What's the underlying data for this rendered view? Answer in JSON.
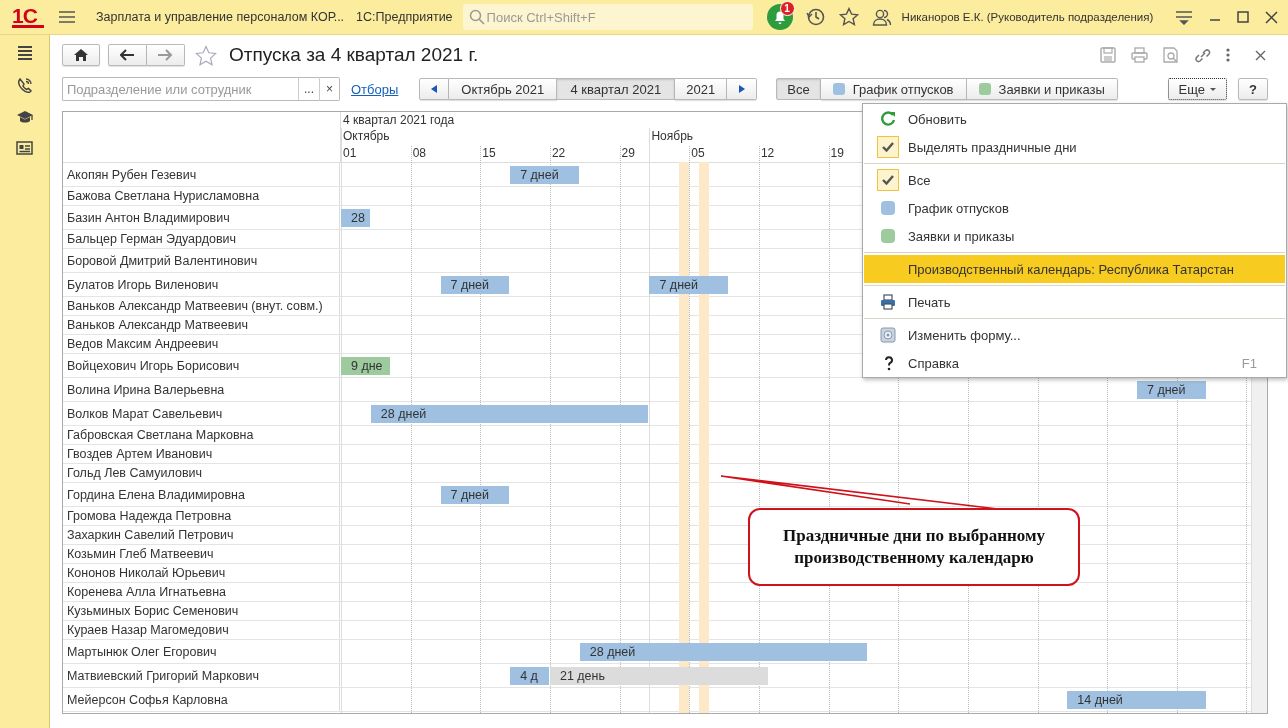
{
  "app_bar": {
    "logo": "1С",
    "title": "Зарплата и управление персоналом КОР...",
    "product": "1С:Предприятие",
    "search": {
      "placeholder": "Поиск Ctrl+Shift+F"
    },
    "notifications": "1",
    "user": "Никаноров Е.К. (Руководитель подразделения)"
  },
  "form": {
    "title": "Отпуска за 4 квартал 2021 г.",
    "filter": {
      "placeholder": "Подразделение или сотрудник"
    },
    "filter_buttons": [
      "...",
      "×"
    ],
    "filters_link": "Отборы",
    "periods": [
      {
        "label": "Октябрь 2021",
        "selected": false
      },
      {
        "label": "4 квартал 2021",
        "selected": true
      },
      {
        "label": "2021",
        "selected": false
      }
    ],
    "views": [
      {
        "label": "Все",
        "selected": true
      },
      {
        "label": "График отпусков",
        "color": "#9fc0e0",
        "selected": false
      },
      {
        "label": "Заявки и приказы",
        "color": "#9dcb9d",
        "selected": false
      }
    ],
    "more_button": "Еще",
    "help_button": "?"
  },
  "timeline": {
    "period": "4 квартал 2021 года",
    "months": [
      "Октябрь",
      "Ноябрь"
    ],
    "ticks": [
      "01",
      "08",
      "15",
      "22",
      "29",
      "05",
      "12",
      "19"
    ],
    "rows": [
      {
        "name": "Акопян Рубен Гезевич",
        "bars": [
          {
            "kind": "schedule",
            "label": "7 дней"
          }
        ]
      },
      {
        "name": "Бажова Светлана Нурисламовна",
        "bars": []
      },
      {
        "name": "Базин Антон Владимирович",
        "bars": [
          {
            "kind": "schedule",
            "label": "28"
          }
        ]
      },
      {
        "name": "Бальцер Герман Эдуардович",
        "bars": []
      },
      {
        "name": "Боровой Дмитрий Валентинович",
        "bars": []
      },
      {
        "name": "Булатов Игорь Виленович",
        "bars": [
          {
            "kind": "schedule",
            "label": "7 дней"
          },
          {
            "kind": "schedule",
            "label": "7 дней"
          }
        ]
      },
      {
        "name": "Ваньков Александр Матвеевич (внут. совм.)",
        "bars": []
      },
      {
        "name": "Ваньков Александр Матвеевич",
        "bars": []
      },
      {
        "name": "Ведов Максим Андреевич",
        "bars": []
      },
      {
        "name": "Войцехович Игорь Борисович",
        "bars": [
          {
            "kind": "order",
            "label": "9 дне"
          }
        ]
      },
      {
        "name": "Волина Ирина Валерьевна",
        "bars": [
          {
            "kind": "schedule",
            "label": "7 дней"
          }
        ]
      },
      {
        "name": "Волков Марат Савельевич",
        "bars": [
          {
            "kind": "schedule",
            "label": "28 дней"
          }
        ]
      },
      {
        "name": "Габровская Светлана Марковна",
        "bars": []
      },
      {
        "name": "Гвоздев Артем Иванович",
        "bars": []
      },
      {
        "name": "Гольд Лев Самуилович",
        "bars": []
      },
      {
        "name": "Гордина Елена Владимировна",
        "bars": [
          {
            "kind": "schedule",
            "label": "7 дней"
          }
        ]
      },
      {
        "name": "Громова Надежда Петровна",
        "bars": []
      },
      {
        "name": "Захаркин Савелий Петрович",
        "bars": []
      },
      {
        "name": "Козьмин Глеб Матвеевич",
        "bars": []
      },
      {
        "name": "Кононов Николай Юрьевич",
        "bars": []
      },
      {
        "name": "Коренева Алла Игнатьевна",
        "bars": []
      },
      {
        "name": "Кузьминых Борис Семенович",
        "bars": []
      },
      {
        "name": "Кураев Назар Магомедович",
        "bars": []
      },
      {
        "name": "Мартынюк Олег Егорович",
        "bars": [
          {
            "kind": "schedule",
            "label": "28 дней"
          }
        ]
      },
      {
        "name": "Матвиевский Григорий Маркович",
        "bars": [
          {
            "kind": "schedule",
            "label": "4 д"
          },
          {
            "kind": "other",
            "label": "21 день"
          }
        ]
      },
      {
        "name": "Мейерсон Софья Карловна",
        "bars": [
          {
            "kind": "schedule",
            "label": "14 дней"
          }
        ]
      }
    ]
  },
  "menu": {
    "items": [
      {
        "kind": "refresh",
        "label": "Обновить",
        "divider_before": false
      },
      {
        "kind": "check",
        "label": "Выделять праздничные дни",
        "checked": true,
        "divider_before": false
      },
      {
        "kind": "check",
        "label": "Все",
        "checked": true,
        "divider_before": true
      },
      {
        "kind": "color",
        "label": "График отпусков",
        "color": "#9fc0e0",
        "divider_before": false
      },
      {
        "kind": "color",
        "label": "Заявки и приказы",
        "color": "#9dcb9d",
        "divider_before": false
      },
      {
        "kind": "plain",
        "label": "Производственный календарь: Республика Татарстан",
        "selected": true,
        "divider_before": true
      },
      {
        "kind": "print",
        "label": "Печать",
        "divider_before": true
      },
      {
        "kind": "form",
        "label": "Изменить форму...",
        "divider_before": true
      },
      {
        "kind": "help",
        "label": "Справка",
        "shortcut": "F1",
        "divider_before": false
      }
    ]
  },
  "callout": {
    "text": "Праздничные дни по выбранному производственному календарю"
  }
}
